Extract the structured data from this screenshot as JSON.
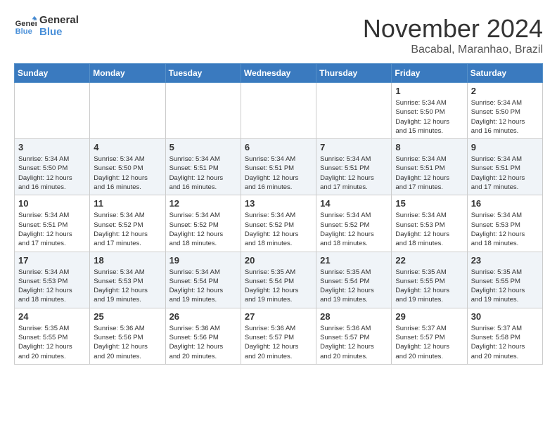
{
  "logo": {
    "line1": "General",
    "line2": "Blue"
  },
  "title": {
    "month": "November 2024",
    "location": "Bacabal, Maranhao, Brazil"
  },
  "headers": [
    "Sunday",
    "Monday",
    "Tuesday",
    "Wednesday",
    "Thursday",
    "Friday",
    "Saturday"
  ],
  "weeks": [
    [
      {
        "day": "",
        "info": ""
      },
      {
        "day": "",
        "info": ""
      },
      {
        "day": "",
        "info": ""
      },
      {
        "day": "",
        "info": ""
      },
      {
        "day": "",
        "info": ""
      },
      {
        "day": "1",
        "info": "Sunrise: 5:34 AM\nSunset: 5:50 PM\nDaylight: 12 hours\nand 15 minutes."
      },
      {
        "day": "2",
        "info": "Sunrise: 5:34 AM\nSunset: 5:50 PM\nDaylight: 12 hours\nand 16 minutes."
      }
    ],
    [
      {
        "day": "3",
        "info": "Sunrise: 5:34 AM\nSunset: 5:50 PM\nDaylight: 12 hours\nand 16 minutes."
      },
      {
        "day": "4",
        "info": "Sunrise: 5:34 AM\nSunset: 5:50 PM\nDaylight: 12 hours\nand 16 minutes."
      },
      {
        "day": "5",
        "info": "Sunrise: 5:34 AM\nSunset: 5:51 PM\nDaylight: 12 hours\nand 16 minutes."
      },
      {
        "day": "6",
        "info": "Sunrise: 5:34 AM\nSunset: 5:51 PM\nDaylight: 12 hours\nand 16 minutes."
      },
      {
        "day": "7",
        "info": "Sunrise: 5:34 AM\nSunset: 5:51 PM\nDaylight: 12 hours\nand 17 minutes."
      },
      {
        "day": "8",
        "info": "Sunrise: 5:34 AM\nSunset: 5:51 PM\nDaylight: 12 hours\nand 17 minutes."
      },
      {
        "day": "9",
        "info": "Sunrise: 5:34 AM\nSunset: 5:51 PM\nDaylight: 12 hours\nand 17 minutes."
      }
    ],
    [
      {
        "day": "10",
        "info": "Sunrise: 5:34 AM\nSunset: 5:51 PM\nDaylight: 12 hours\nand 17 minutes."
      },
      {
        "day": "11",
        "info": "Sunrise: 5:34 AM\nSunset: 5:52 PM\nDaylight: 12 hours\nand 17 minutes."
      },
      {
        "day": "12",
        "info": "Sunrise: 5:34 AM\nSunset: 5:52 PM\nDaylight: 12 hours\nand 18 minutes."
      },
      {
        "day": "13",
        "info": "Sunrise: 5:34 AM\nSunset: 5:52 PM\nDaylight: 12 hours\nand 18 minutes."
      },
      {
        "day": "14",
        "info": "Sunrise: 5:34 AM\nSunset: 5:52 PM\nDaylight: 12 hours\nand 18 minutes."
      },
      {
        "day": "15",
        "info": "Sunrise: 5:34 AM\nSunset: 5:53 PM\nDaylight: 12 hours\nand 18 minutes."
      },
      {
        "day": "16",
        "info": "Sunrise: 5:34 AM\nSunset: 5:53 PM\nDaylight: 12 hours\nand 18 minutes."
      }
    ],
    [
      {
        "day": "17",
        "info": "Sunrise: 5:34 AM\nSunset: 5:53 PM\nDaylight: 12 hours\nand 18 minutes."
      },
      {
        "day": "18",
        "info": "Sunrise: 5:34 AM\nSunset: 5:53 PM\nDaylight: 12 hours\nand 19 minutes."
      },
      {
        "day": "19",
        "info": "Sunrise: 5:34 AM\nSunset: 5:54 PM\nDaylight: 12 hours\nand 19 minutes."
      },
      {
        "day": "20",
        "info": "Sunrise: 5:35 AM\nSunset: 5:54 PM\nDaylight: 12 hours\nand 19 minutes."
      },
      {
        "day": "21",
        "info": "Sunrise: 5:35 AM\nSunset: 5:54 PM\nDaylight: 12 hours\nand 19 minutes."
      },
      {
        "day": "22",
        "info": "Sunrise: 5:35 AM\nSunset: 5:55 PM\nDaylight: 12 hours\nand 19 minutes."
      },
      {
        "day": "23",
        "info": "Sunrise: 5:35 AM\nSunset: 5:55 PM\nDaylight: 12 hours\nand 19 minutes."
      }
    ],
    [
      {
        "day": "24",
        "info": "Sunrise: 5:35 AM\nSunset: 5:55 PM\nDaylight: 12 hours\nand 20 minutes."
      },
      {
        "day": "25",
        "info": "Sunrise: 5:36 AM\nSunset: 5:56 PM\nDaylight: 12 hours\nand 20 minutes."
      },
      {
        "day": "26",
        "info": "Sunrise: 5:36 AM\nSunset: 5:56 PM\nDaylight: 12 hours\nand 20 minutes."
      },
      {
        "day": "27",
        "info": "Sunrise: 5:36 AM\nSunset: 5:57 PM\nDaylight: 12 hours\nand 20 minutes."
      },
      {
        "day": "28",
        "info": "Sunrise: 5:36 AM\nSunset: 5:57 PM\nDaylight: 12 hours\nand 20 minutes."
      },
      {
        "day": "29",
        "info": "Sunrise: 5:37 AM\nSunset: 5:57 PM\nDaylight: 12 hours\nand 20 minutes."
      },
      {
        "day": "30",
        "info": "Sunrise: 5:37 AM\nSunset: 5:58 PM\nDaylight: 12 hours\nand 20 minutes."
      }
    ]
  ]
}
